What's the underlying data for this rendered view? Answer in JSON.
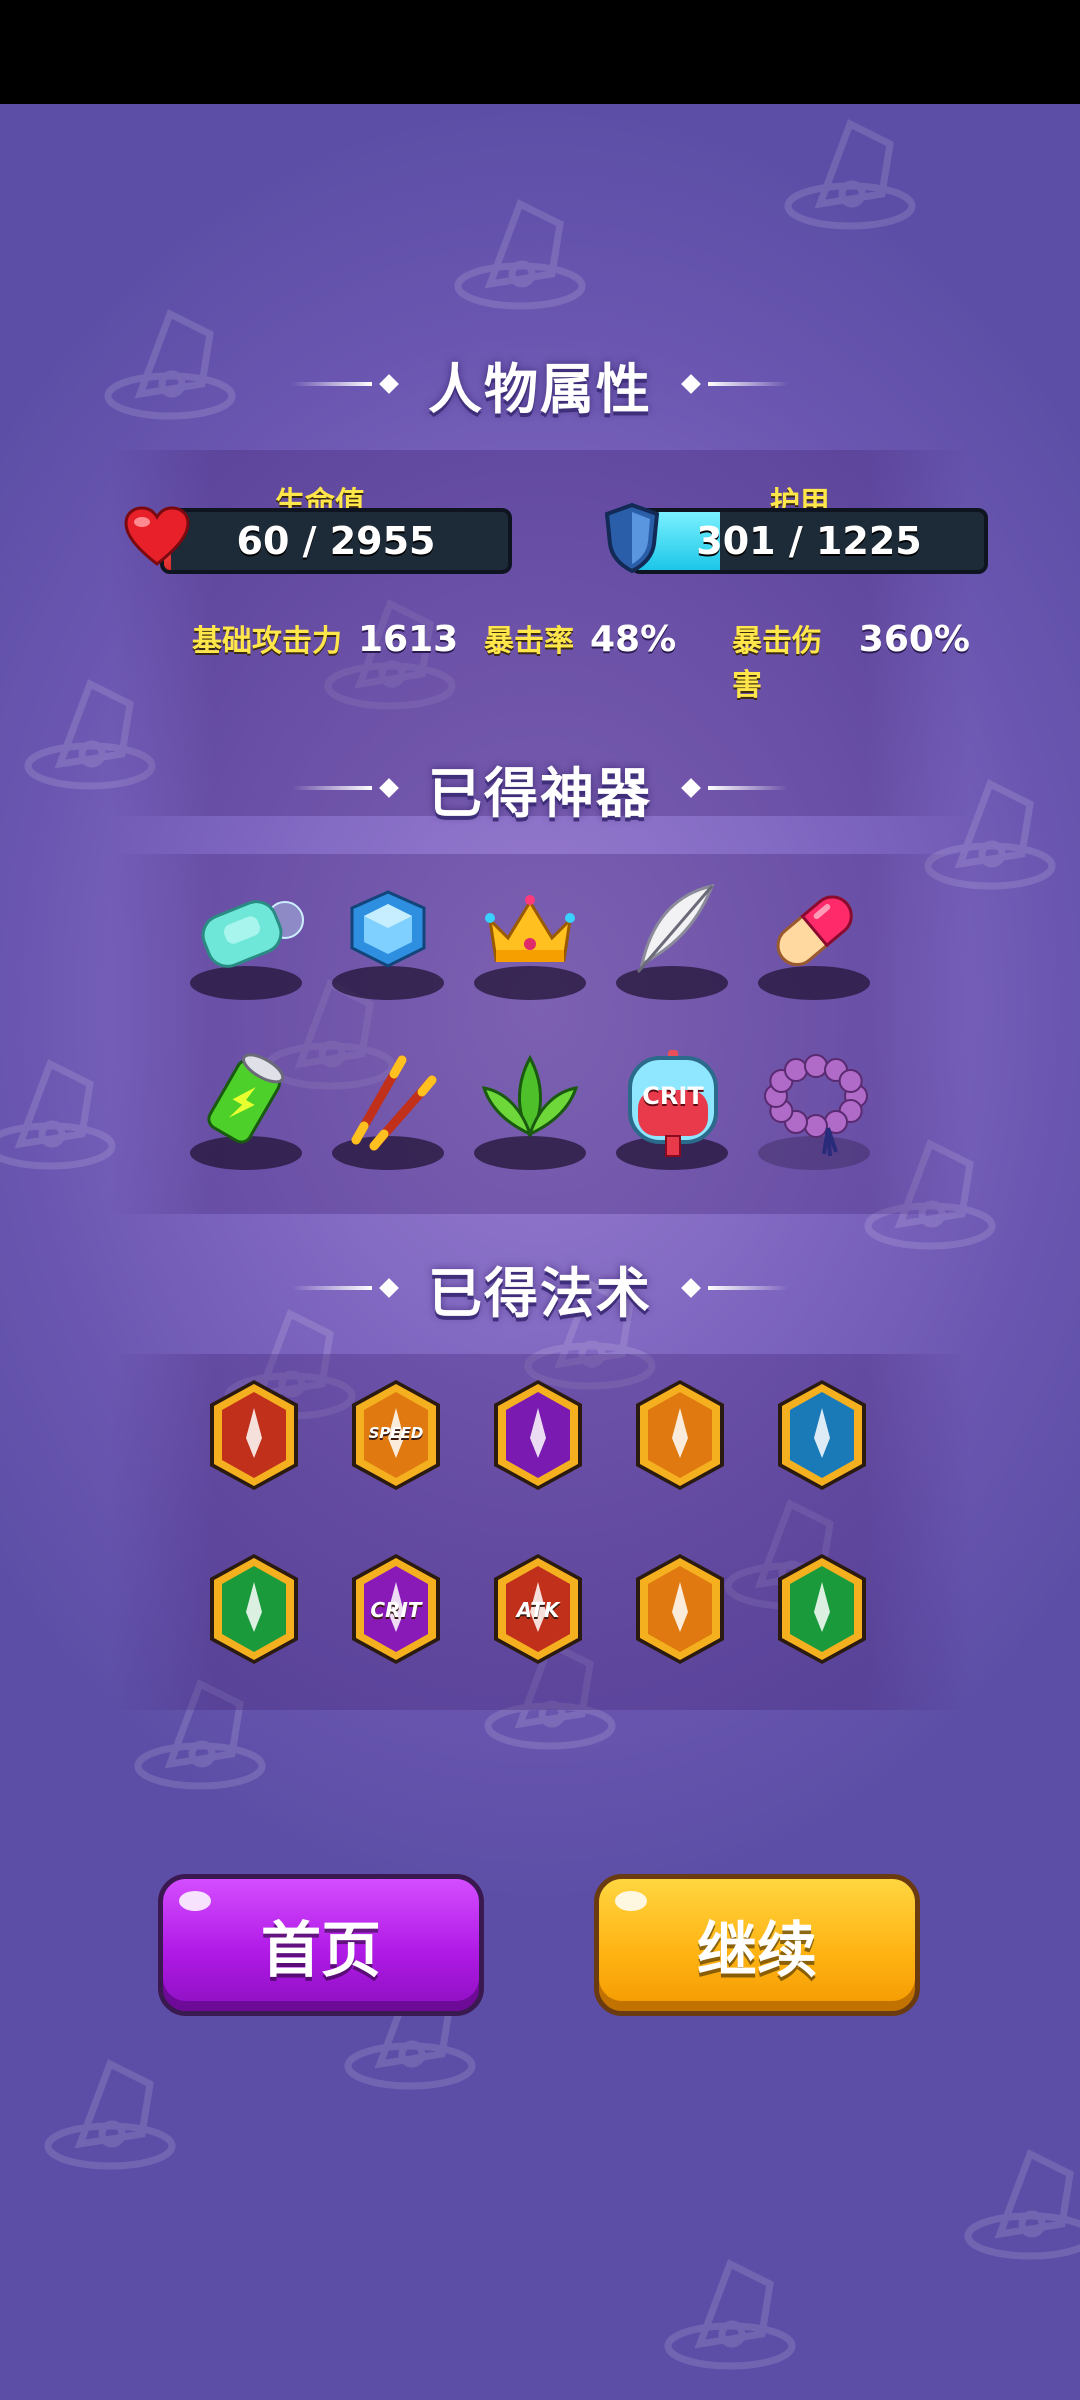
{
  "sections": {
    "attributes_title": "人物属性",
    "artifacts_title": "已得神器",
    "spells_title": "已得法术"
  },
  "health": {
    "label": "生命值",
    "value_text": "60 / 2955",
    "current": 60,
    "max": 2955,
    "icon": "heart-icon"
  },
  "armor": {
    "label": "护甲",
    "value_text": "301 / 1225",
    "current": 301,
    "max": 1225,
    "icon": "shield-icon"
  },
  "stats": [
    {
      "label": "基础攻击力",
      "value": "1613"
    },
    {
      "label": "暴击率",
      "value": "48%"
    },
    {
      "label": "暴击伤害",
      "value": "360%"
    }
  ],
  "artifacts": [
    {
      "name": "soap-bar"
    },
    {
      "name": "blue-gem"
    },
    {
      "name": "golden-crown"
    },
    {
      "name": "feather"
    },
    {
      "name": "pill-capsule"
    },
    {
      "name": "battery"
    },
    {
      "name": "red-chopsticks"
    },
    {
      "name": "green-herb"
    },
    {
      "name": "crit-potion",
      "label": "CRIT"
    },
    {
      "name": "prayer-beads"
    }
  ],
  "spells": [
    {
      "name": "twin-claw",
      "color": "#c0301a"
    },
    {
      "name": "speed-arrow",
      "color": "#e07a10",
      "label": "SPEED"
    },
    {
      "name": "purple-flame",
      "color": "#7a1ab0"
    },
    {
      "name": "triple-shot",
      "color": "#e07a10"
    },
    {
      "name": "split-shot",
      "color": "#1a7ab8"
    },
    {
      "name": "skull-arrow",
      "color": "#1a9a3a"
    },
    {
      "name": "crit-burst",
      "color": "#8a1ab8",
      "label": "CRIT"
    },
    {
      "name": "atk-up",
      "color": "#c0301a",
      "label": "ATK"
    },
    {
      "name": "crossed-swords",
      "color": "#e07a10"
    },
    {
      "name": "sheep",
      "color": "#1a9a3a"
    }
  ],
  "buttons": {
    "home": "首页",
    "continue": "继续"
  },
  "colors": {
    "accent_yellow": "#ffe64a",
    "button_purple": "#b01ae6",
    "button_orange": "#ffb414"
  }
}
